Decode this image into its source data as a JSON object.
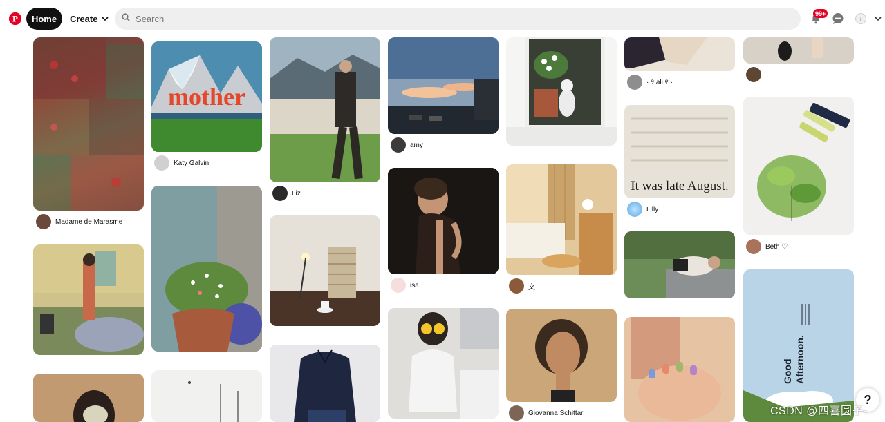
{
  "header": {
    "home_label": "Home",
    "create_label": "Create",
    "search_placeholder": "Search",
    "notification_badge": "99+",
    "profile_initial": "i"
  },
  "pins": {
    "p1": {
      "user": "Madame de Marasme"
    },
    "p2": {
      "user": "Katy Galvin",
      "overlay": "mother"
    },
    "p3": {
      "user": "Liz"
    },
    "p4": {
      "user": "amy"
    },
    "p5": {
      "user": ""
    },
    "p6": {
      "user": "· ୨ ali ୧ ·"
    },
    "p7": {
      "user": ""
    },
    "p8": {
      "user": ""
    },
    "p9": {
      "user": ""
    },
    "p10": {
      "user": ""
    },
    "p11": {
      "user": "isa"
    },
    "p12": {
      "user": "文"
    },
    "p13": {
      "user": "Lilly",
      "overlay": "It was late August."
    },
    "p14": {
      "user": "Beth ♡"
    },
    "p15": {
      "user": ""
    },
    "p16": {
      "user": ""
    },
    "p17": {
      "user": ""
    },
    "p18": {
      "user": ""
    },
    "p19": {
      "user": "Giovanna Schittar"
    },
    "p20": {
      "user": ""
    },
    "p21": {
      "user": "",
      "overlay_line1": "Good",
      "overlay_line2": "Afternoon."
    }
  },
  "help_label": "?",
  "watermark": "CSDN @四喜圆子-"
}
